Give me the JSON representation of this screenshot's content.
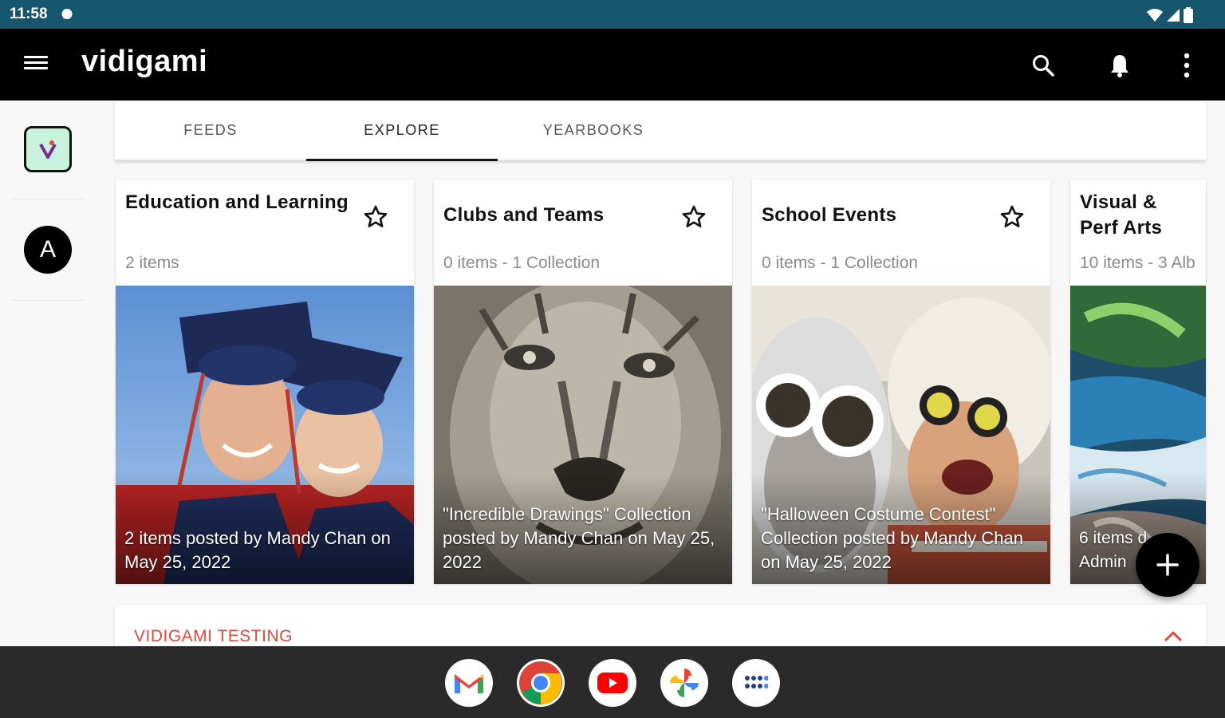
{
  "status": {
    "time": "11:58"
  },
  "app": {
    "name": "vidigami"
  },
  "tabs": [
    {
      "label": "FEEDS",
      "active": false
    },
    {
      "label": "EXPLORE",
      "active": true
    },
    {
      "label": "YEARBOOKS",
      "active": false
    }
  ],
  "rail": {
    "avatar_letter": "A"
  },
  "cards": [
    {
      "title": "Education and Learning",
      "subtitle": "2 items",
      "caption": "2 items posted by Mandy Chan on May 25, 2022"
    },
    {
      "title": "Clubs and Teams",
      "subtitle": "0 items - 1 Collection",
      "caption": "\"Incredible Drawings\" Collection posted by Mandy Chan on May 25, 2022"
    },
    {
      "title": "School Events",
      "subtitle": "0 items - 1 Collection",
      "caption": "\"Halloween Costume Contest\" Collection posted by Mandy Chan on May 25, 2022"
    },
    {
      "title": "Visual & Perf Arts",
      "subtitle": "10 items - 3 Alb",
      "caption": "6 items d Admin"
    }
  ],
  "section": {
    "title": "VIDIGAMI TESTING"
  },
  "dock": [
    {
      "name": "gmail"
    },
    {
      "name": "chrome"
    },
    {
      "name": "youtube"
    },
    {
      "name": "photos"
    },
    {
      "name": "app-drawer"
    }
  ],
  "colors": {
    "status_bar": "#17566f",
    "app_bar": "#000000",
    "accent_red": "#e2493b"
  }
}
